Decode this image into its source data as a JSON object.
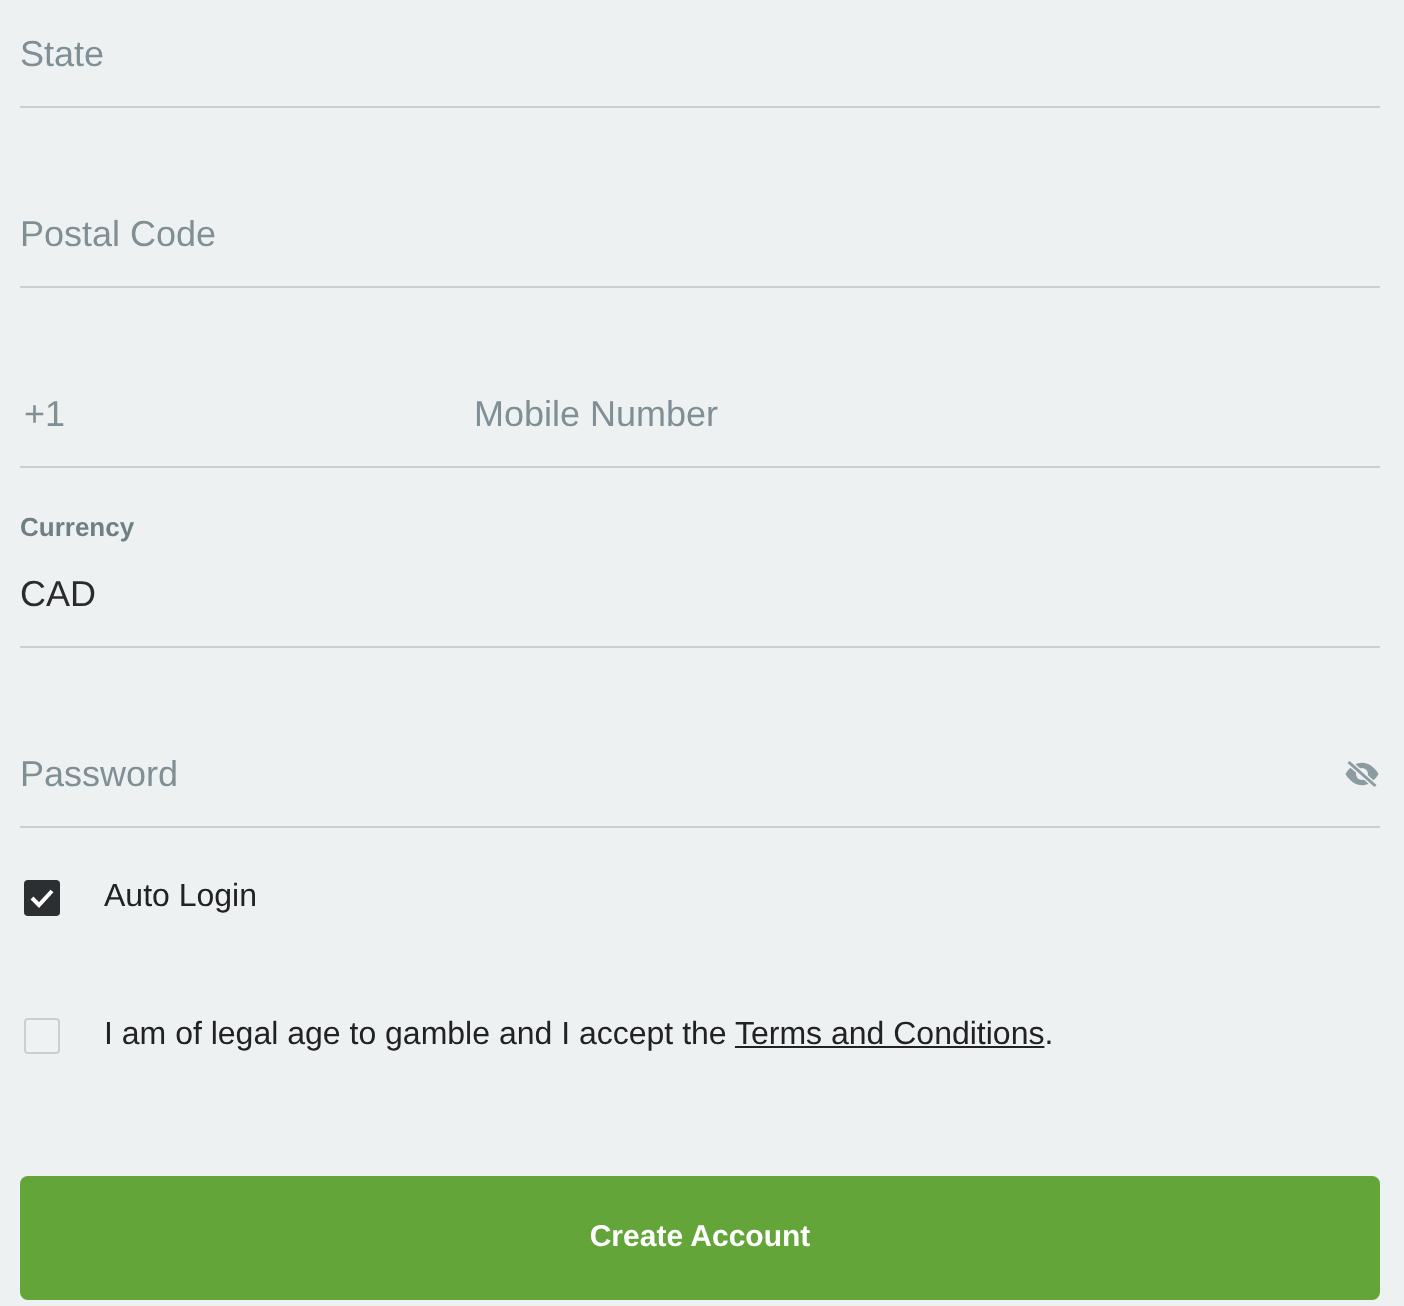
{
  "fields": [
    {
      "kind": "text",
      "placeholder": "State"
    },
    {
      "kind": "text",
      "placeholder": "Postal Code"
    },
    {
      "kind": "phone",
      "prefix": "+1",
      "placeholder": "Mobile Number"
    },
    {
      "kind": "select",
      "label": "Currency",
      "value": "CAD"
    },
    {
      "kind": "password",
      "placeholder": "Password"
    }
  ],
  "checkboxes": [
    {
      "text": "Auto Login",
      "checked": true
    },
    {
      "text": "I am of legal age to gamble and I accept the ",
      "link": "Terms and Conditions",
      "after": ".",
      "checked": false
    }
  ],
  "submit": {
    "label": "Create Account"
  }
}
